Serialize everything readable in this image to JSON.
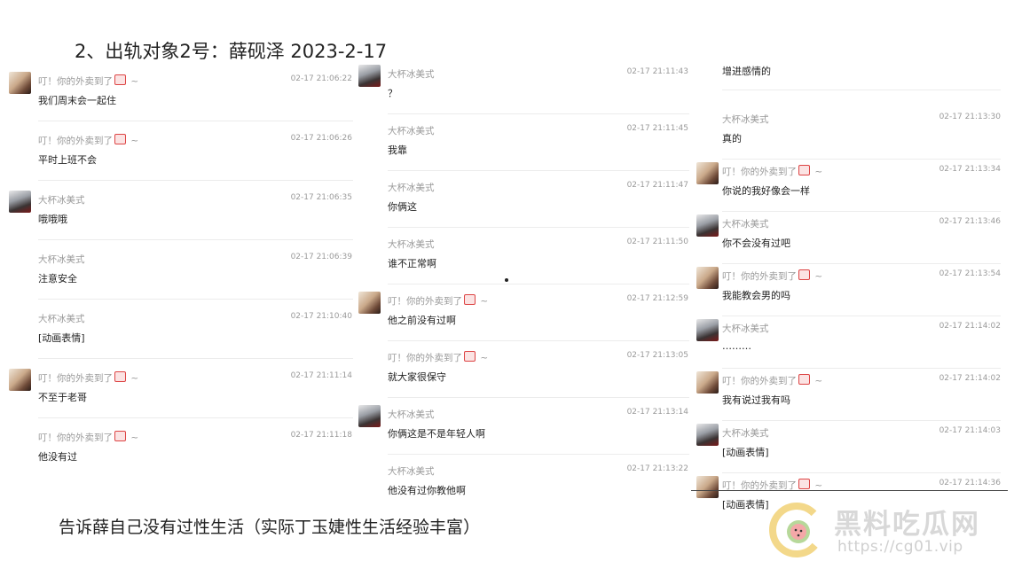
{
  "title": "2、出轨对象2号：薛砚泽 2023-2-17",
  "caption": "告诉薛自己没有过性生活（实际丁玉婕性生活经验丰富）",
  "watermark": {
    "brand": "黑料吃瓜网",
    "url": "https://cg01.vip"
  },
  "columns": [
    {
      "messages": [
        {
          "sender": "叮！你的外卖到了",
          "suffix": "~",
          "time": "02-17 21:06:22",
          "text": "我们周末会一起住",
          "avatar": "a"
        },
        {
          "sender": "叮！你的外卖到了",
          "suffix": "~",
          "time": "02-17 21:06:26",
          "text": "平时上班不会",
          "avatar": ""
        },
        {
          "sender": "大杯冰美式",
          "suffix": "",
          "time": "02-17 21:06:35",
          "text": "哦哦哦",
          "avatar": "b"
        },
        {
          "sender": "大杯冰美式",
          "suffix": "",
          "time": "02-17 21:06:39",
          "text": "注意安全",
          "avatar": ""
        },
        {
          "sender": "大杯冰美式",
          "suffix": "",
          "time": "02-17 21:10:40",
          "text": "[动画表情]",
          "avatar": ""
        },
        {
          "sender": "叮！你的外卖到了",
          "suffix": "~",
          "time": "02-17 21:11:14",
          "text": "不至于老哥",
          "avatar": "a"
        },
        {
          "sender": "叮！你的外卖到了",
          "suffix": "~",
          "time": "02-17 21:11:18",
          "text": "他没有过",
          "avatar": ""
        }
      ]
    },
    {
      "messages": [
        {
          "sender": "大杯冰美式",
          "suffix": "",
          "time": "02-17 21:11:43",
          "text": "？",
          "avatar": "b"
        },
        {
          "sender": "大杯冰美式",
          "suffix": "",
          "time": "02-17 21:11:45",
          "text": "我靠",
          "avatar": ""
        },
        {
          "sender": "大杯冰美式",
          "suffix": "",
          "time": "02-17 21:11:47",
          "text": "你俩这",
          "avatar": ""
        },
        {
          "sender": "大杯冰美式",
          "suffix": "",
          "time": "02-17 21:11:50",
          "text": "谁不正常啊",
          "avatar": ""
        },
        {
          "sender": "叮！你的外卖到了",
          "suffix": "~",
          "time": "02-17 21:12:59",
          "text": "他之前没有过啊",
          "avatar": "a"
        },
        {
          "sender": "叮！你的外卖到了",
          "suffix": "~",
          "time": "02-17 21:13:05",
          "text": "就大家很保守",
          "avatar": ""
        },
        {
          "sender": "大杯冰美式",
          "suffix": "",
          "time": "02-17 21:13:14",
          "text": "你俩这是不是年轻人啊",
          "avatar": "b"
        },
        {
          "sender": "大杯冰美式",
          "suffix": "",
          "time": "02-17 21:13:22",
          "text": "他没有过你教他啊",
          "avatar": ""
        }
      ]
    },
    {
      "messages": [
        {
          "sender": "",
          "suffix": "",
          "time": "",
          "text": "增进感情的",
          "avatar": ""
        },
        {
          "sender": "大杯冰美式",
          "suffix": "",
          "time": "02-17 21:13:30",
          "text": "真的",
          "avatar": ""
        },
        {
          "sender": "叮！你的外卖到了",
          "suffix": "~",
          "time": "02-17 21:13:34",
          "text": "你说的我好像会一样",
          "avatar": "a"
        },
        {
          "sender": "大杯冰美式",
          "suffix": "",
          "time": "02-17 21:13:46",
          "text": "你不会没有过吧",
          "avatar": "b"
        },
        {
          "sender": "叮！你的外卖到了",
          "suffix": "~",
          "time": "02-17 21:13:54",
          "text": "我能教会男的吗",
          "avatar": "a"
        },
        {
          "sender": "大杯冰美式",
          "suffix": "",
          "time": "02-17 21:14:02",
          "text": "………",
          "avatar": "b"
        },
        {
          "sender": "叮！你的外卖到了",
          "suffix": "~",
          "time": "02-17 21:14:02",
          "text": "我有说过我有吗",
          "avatar": "a"
        },
        {
          "sender": "大杯冰美式",
          "suffix": "",
          "time": "02-17 21:14:03",
          "text": "[动画表情]",
          "avatar": "b"
        },
        {
          "sender": "叮！你的外卖到了",
          "suffix": "~",
          "time": "02-17 21:14:36",
          "text": "[动画表情]",
          "avatar": "a"
        }
      ]
    }
  ]
}
